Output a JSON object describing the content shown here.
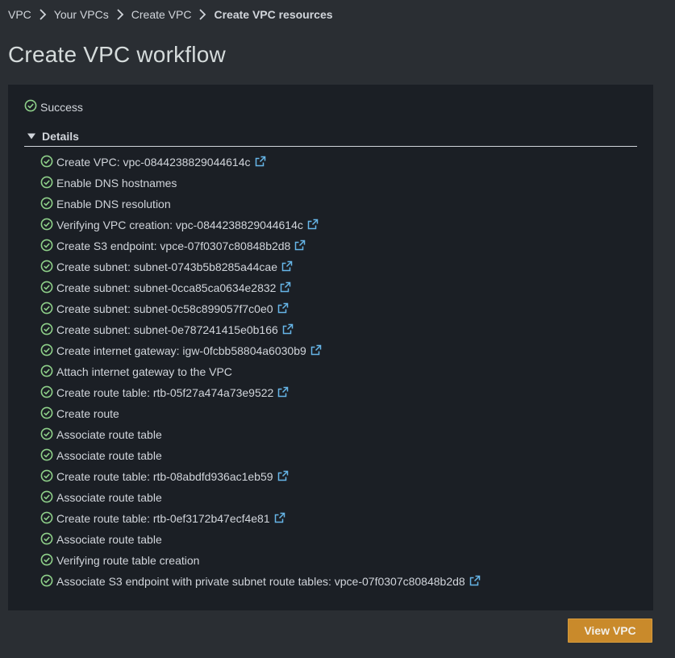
{
  "breadcrumb": {
    "items": [
      {
        "label": "VPC",
        "current": false
      },
      {
        "label": "Your VPCs",
        "current": false
      },
      {
        "label": "Create VPC",
        "current": false
      },
      {
        "label": "Create VPC resources",
        "current": true
      }
    ]
  },
  "page": {
    "title": "Create VPC workflow"
  },
  "status": {
    "label": "Success"
  },
  "details": {
    "label": "Details",
    "expanded": true,
    "steps": [
      {
        "text": "Create VPC: vpc-0844238829044614c",
        "external_link": true
      },
      {
        "text": "Enable DNS hostnames",
        "external_link": false
      },
      {
        "text": "Enable DNS resolution",
        "external_link": false
      },
      {
        "text": "Verifying VPC creation: vpc-0844238829044614c",
        "external_link": true
      },
      {
        "text": "Create S3 endpoint: vpce-07f0307c80848b2d8",
        "external_link": true
      },
      {
        "text": "Create subnet: subnet-0743b5b8285a44cae",
        "external_link": true
      },
      {
        "text": "Create subnet: subnet-0cca85ca0634e2832",
        "external_link": true
      },
      {
        "text": "Create subnet: subnet-0c58c899057f7c0e0",
        "external_link": true
      },
      {
        "text": "Create subnet: subnet-0e787241415e0b166",
        "external_link": true
      },
      {
        "text": "Create internet gateway: igw-0fcbb58804a6030b9",
        "external_link": true
      },
      {
        "text": "Attach internet gateway to the VPC",
        "external_link": false
      },
      {
        "text": "Create route table: rtb-05f27a474a73e9522",
        "external_link": true
      },
      {
        "text": "Create route",
        "external_link": false
      },
      {
        "text": "Associate route table",
        "external_link": false
      },
      {
        "text": "Associate route table",
        "external_link": false
      },
      {
        "text": "Create route table: rtb-08abdfd936ac1eb59",
        "external_link": true
      },
      {
        "text": "Associate route table",
        "external_link": false
      },
      {
        "text": "Create route table: rtb-0ef3172b47ecf4e81",
        "external_link": true
      },
      {
        "text": "Associate route table",
        "external_link": false
      },
      {
        "text": "Verifying route table creation",
        "external_link": false
      },
      {
        "text": "Associate S3 endpoint with private subnet route tables: vpce-07f0307c80848b2d8",
        "external_link": true
      }
    ]
  },
  "footer": {
    "view_vpc_label": "View VPC"
  },
  "colors": {
    "page_bg": "#2a2e33",
    "panel_bg": "#1b1f25",
    "text": "#d1d5db",
    "success_green": "#8fd18a",
    "link_blue": "#66b6e8",
    "primary_button": "#c98a2b"
  },
  "icons": {
    "status": "check-circle-icon",
    "link": "external-link-icon",
    "separator": "chevron-right-icon",
    "toggle": "caret-down-icon"
  }
}
